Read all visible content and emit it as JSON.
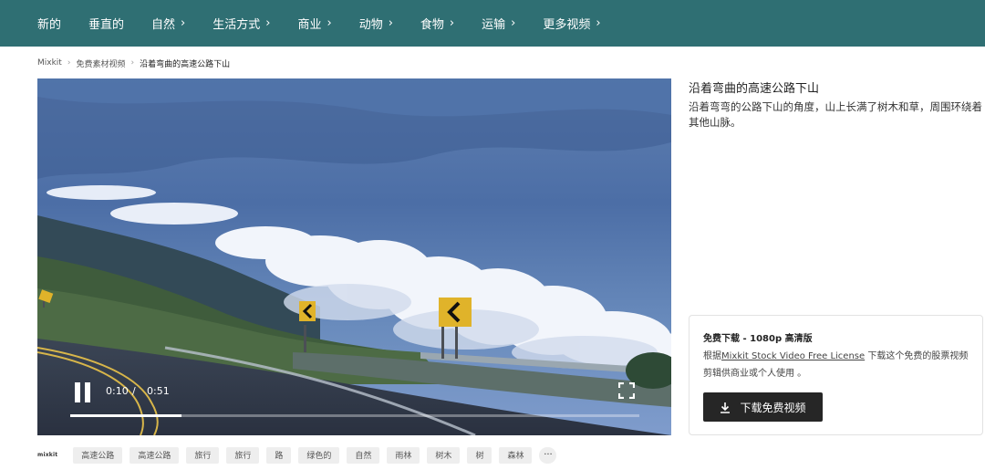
{
  "nav": {
    "items": [
      {
        "label": "新的",
        "chevron": false
      },
      {
        "label": "垂直的",
        "chevron": false
      },
      {
        "label": "自然",
        "chevron": true
      },
      {
        "label": "生活方式",
        "chevron": true
      },
      {
        "label": "商业",
        "chevron": true
      },
      {
        "label": "动物",
        "chevron": true
      },
      {
        "label": "食物",
        "chevron": true
      },
      {
        "label": "运输",
        "chevron": true
      },
      {
        "label": "更多视频",
        "chevron": true
      }
    ],
    "chevron_glyph": "›",
    "background": "#2f6f73"
  },
  "breadcrumb": {
    "items": [
      "Mixkit",
      "免费素材视频",
      "沿着弯曲的高速公路下山"
    ],
    "separator": "›"
  },
  "player": {
    "current_time": "0:10",
    "separator": "/",
    "duration": "0:51",
    "progress": 0.196,
    "state": "playing"
  },
  "video": {
    "title": "沿着弯曲的高速公路下山",
    "description": "沿着弯弯的公路下山的角度，山上长满了树木和草，周围环绕着其他山脉。"
  },
  "download": {
    "heading": "免费下载 - 1080p 高清版",
    "license_prefix": "根据",
    "license_link": "Mixkit Stock Video Free License",
    "license_suffix": " 下载这个免费的股票视频剪辑供商业或个人使用 。",
    "button_label": "下载免费视频",
    "button_color": "#262626"
  },
  "tags": {
    "logo": "mixkit",
    "items": [
      "高速公路",
      "高速公路",
      "旅行",
      "旅行",
      "路",
      "绿色的",
      "自然",
      "雨林",
      "树木",
      "树",
      "森林"
    ],
    "more_label": "···"
  }
}
